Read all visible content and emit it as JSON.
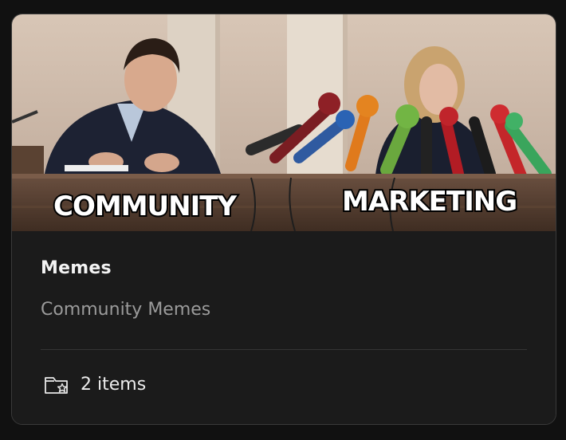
{
  "card": {
    "image": {
      "top_caption": "",
      "left_caption": "COMMUNITY",
      "right_caption": "MARKETING"
    },
    "title": "Memes",
    "description": "Community Memes",
    "count_label": "2 items",
    "icon": "folder-star-icon"
  }
}
